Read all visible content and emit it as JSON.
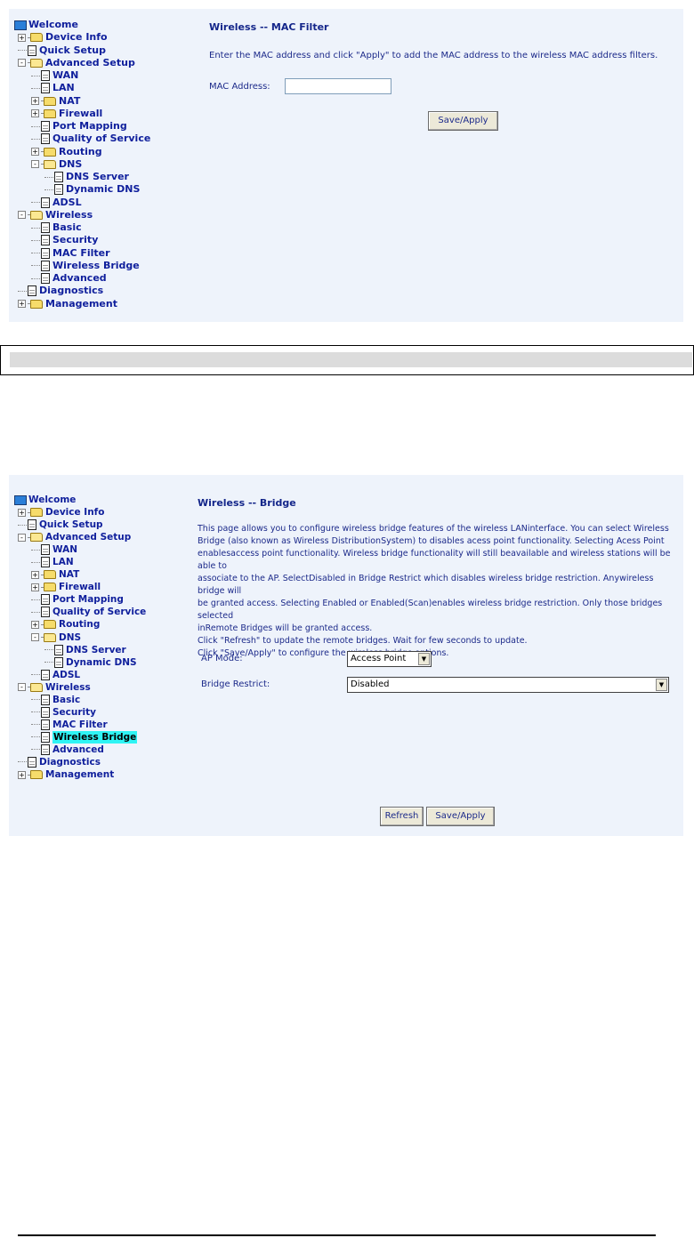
{
  "screen1": {
    "tree": [
      {
        "label": "Welcome",
        "depth": 0,
        "kind": "root"
      },
      {
        "label": "Device Info",
        "depth": 1,
        "kind": "folder",
        "expander": "+"
      },
      {
        "label": "Quick Setup",
        "depth": 1,
        "kind": "page"
      },
      {
        "label": "Advanced Setup",
        "depth": 1,
        "kind": "folder-open",
        "expander": "-"
      },
      {
        "label": "WAN",
        "depth": 2,
        "kind": "page"
      },
      {
        "label": "LAN",
        "depth": 2,
        "kind": "page"
      },
      {
        "label": "NAT",
        "depth": 2,
        "kind": "folder",
        "expander": "+"
      },
      {
        "label": "Firewall",
        "depth": 2,
        "kind": "folder",
        "expander": "+"
      },
      {
        "label": "Port Mapping",
        "depth": 2,
        "kind": "page"
      },
      {
        "label": "Quality of Service",
        "depth": 2,
        "kind": "page"
      },
      {
        "label": "Routing",
        "depth": 2,
        "kind": "folder",
        "expander": "+"
      },
      {
        "label": "DNS",
        "depth": 2,
        "kind": "folder-open",
        "expander": "-"
      },
      {
        "label": "DNS Server",
        "depth": 3,
        "kind": "page"
      },
      {
        "label": "Dynamic DNS",
        "depth": 3,
        "kind": "page"
      },
      {
        "label": "ADSL",
        "depth": 2,
        "kind": "page"
      },
      {
        "label": "Wireless",
        "depth": 1,
        "kind": "folder-open",
        "expander": "-"
      },
      {
        "label": "Basic",
        "depth": 2,
        "kind": "page"
      },
      {
        "label": "Security",
        "depth": 2,
        "kind": "page"
      },
      {
        "label": "MAC Filter",
        "depth": 2,
        "kind": "page"
      },
      {
        "label": "Wireless Bridge",
        "depth": 2,
        "kind": "page"
      },
      {
        "label": "Advanced",
        "depth": 2,
        "kind": "page"
      },
      {
        "label": "Diagnostics",
        "depth": 1,
        "kind": "page"
      },
      {
        "label": "Management",
        "depth": 1,
        "kind": "folder",
        "expander": "+"
      }
    ],
    "title": "Wireless -- MAC Filter",
    "instructions": "Enter the MAC address and click \"Apply\" to add the MAC address to the wireless MAC address filters.",
    "mac_label": "MAC Address:",
    "mac_value": "",
    "save_label": "Save/Apply"
  },
  "screen2": {
    "tree": [
      {
        "label": "Welcome",
        "depth": 0,
        "kind": "root"
      },
      {
        "label": "Device Info",
        "depth": 1,
        "kind": "folder",
        "expander": "+"
      },
      {
        "label": "Quick Setup",
        "depth": 1,
        "kind": "page"
      },
      {
        "label": "Advanced Setup",
        "depth": 1,
        "kind": "folder-open",
        "expander": "-"
      },
      {
        "label": "WAN",
        "depth": 2,
        "kind": "page"
      },
      {
        "label": "LAN",
        "depth": 2,
        "kind": "page"
      },
      {
        "label": "NAT",
        "depth": 2,
        "kind": "folder",
        "expander": "+"
      },
      {
        "label": "Firewall",
        "depth": 2,
        "kind": "folder",
        "expander": "+"
      },
      {
        "label": "Port Mapping",
        "depth": 2,
        "kind": "page"
      },
      {
        "label": "Quality of Service",
        "depth": 2,
        "kind": "page"
      },
      {
        "label": "Routing",
        "depth": 2,
        "kind": "folder",
        "expander": "+"
      },
      {
        "label": "DNS",
        "depth": 2,
        "kind": "folder-open",
        "expander": "-"
      },
      {
        "label": "DNS Server",
        "depth": 3,
        "kind": "page"
      },
      {
        "label": "Dynamic DNS",
        "depth": 3,
        "kind": "page"
      },
      {
        "label": "ADSL",
        "depth": 2,
        "kind": "page"
      },
      {
        "label": "Wireless",
        "depth": 1,
        "kind": "folder-open",
        "expander": "-"
      },
      {
        "label": "Basic",
        "depth": 2,
        "kind": "page"
      },
      {
        "label": "Security",
        "depth": 2,
        "kind": "page"
      },
      {
        "label": "MAC Filter",
        "depth": 2,
        "kind": "page"
      },
      {
        "label": "Wireless Bridge",
        "depth": 2,
        "kind": "page",
        "selected": true
      },
      {
        "label": "Advanced",
        "depth": 2,
        "kind": "page"
      },
      {
        "label": "Diagnostics",
        "depth": 1,
        "kind": "page"
      },
      {
        "label": "Management",
        "depth": 1,
        "kind": "folder",
        "expander": "+"
      }
    ],
    "title": "Wireless -- Bridge",
    "description_lines": [
      "This page allows you to configure wireless bridge features of the wireless LANinterface. You can select Wireless",
      "Bridge (also known as Wireless DistributionSystem) to disables acess point functionality. Selecting Acess Point",
      "enablesaccess point functionality. Wireless bridge functionality will still beavailable and wireless stations will be able to",
      "associate to the AP. SelectDisabled in Bridge Restrict which disables wireless bridge restriction. Anywireless bridge will",
      "be granted access. Selecting Enabled or Enabled(Scan)enables wireless bridge restriction. Only those bridges selected",
      "inRemote Bridges will be granted access.",
      "Click \"Refresh\" to update the remote bridges. Wait for few seconds to update.",
      "Click \"Save/Apply\" to configure the wireless bridge options."
    ],
    "ap_mode_label": "AP Mode:",
    "ap_mode_value": "Access Point",
    "bridge_restrict_label": "Bridge Restrict:",
    "bridge_restrict_value": "Disabled",
    "refresh_label": "Refresh",
    "save_label": "Save/Apply"
  },
  "colors": {
    "panel_bg": "#eef3fb",
    "link_text": "#0f1f9c",
    "selected_highlight": "#2ff4f4"
  }
}
